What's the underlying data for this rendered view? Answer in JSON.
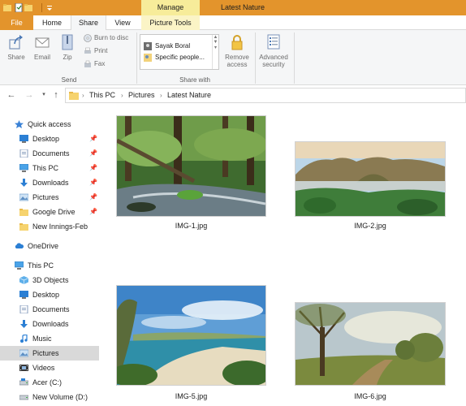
{
  "titlebar": {
    "contextual_tab": "Manage",
    "window_title": "Latest Nature"
  },
  "tabs": {
    "file": "File",
    "home": "Home",
    "share": "Share",
    "view": "View",
    "picture_tools": "Picture Tools"
  },
  "ribbon": {
    "send": {
      "share": "Share",
      "email": "Email",
      "zip": "Zip",
      "burn_to_disc": "Burn to disc",
      "print": "Print",
      "fax": "Fax",
      "group_label": "Send"
    },
    "share_with": {
      "items": [
        "Sayak Boral",
        "Specific people..."
      ],
      "remove_access_line1": "Remove",
      "remove_access_line2": "access",
      "group_label": "Share with"
    },
    "advanced_security_line1": "Advanced",
    "advanced_security_line2": "security"
  },
  "address": {
    "crumbs": [
      "This PC",
      "Pictures",
      "Latest Nature"
    ]
  },
  "sidebar": {
    "items": [
      {
        "label": "Quick access",
        "icon": "star-icon"
      },
      {
        "label": "Desktop",
        "icon": "desktop-icon"
      },
      {
        "label": "Documents",
        "icon": "documents-icon"
      },
      {
        "label": "This PC",
        "icon": "computer-icon"
      },
      {
        "label": "Downloads",
        "icon": "download-arrow-icon"
      },
      {
        "label": "Pictures",
        "icon": "pictures-icon"
      },
      {
        "label": "Google Drive",
        "icon": "folder-icon"
      },
      {
        "label": "New Innings-Feb",
        "icon": "folder-icon"
      },
      {
        "label": "OneDrive",
        "icon": "cloud-icon"
      },
      {
        "label": "This PC",
        "icon": "computer-icon"
      },
      {
        "label": "3D Objects",
        "icon": "cube-icon"
      },
      {
        "label": "Desktop",
        "icon": "desktop-icon"
      },
      {
        "label": "Documents",
        "icon": "documents-icon"
      },
      {
        "label": "Downloads",
        "icon": "download-arrow-icon"
      },
      {
        "label": "Music",
        "icon": "music-note-icon"
      },
      {
        "label": "Pictures",
        "icon": "pictures-icon"
      },
      {
        "label": "Videos",
        "icon": "video-icon"
      },
      {
        "label": "Acer (C:)",
        "icon": "drive-icon"
      },
      {
        "label": "New Volume (D:)",
        "icon": "drive-icon"
      }
    ],
    "pin_glyph": "📌"
  },
  "files": [
    {
      "name": "IMG-1.jpg"
    },
    {
      "name": "IMG-2.jpg"
    },
    {
      "name": "IMG-5.jpg"
    },
    {
      "name": "IMG-6.jpg"
    }
  ],
  "colors": {
    "accent_orange": "#e3942c",
    "manage_yellow": "#f7ec9a",
    "selected_gray": "#d9d9d9"
  }
}
